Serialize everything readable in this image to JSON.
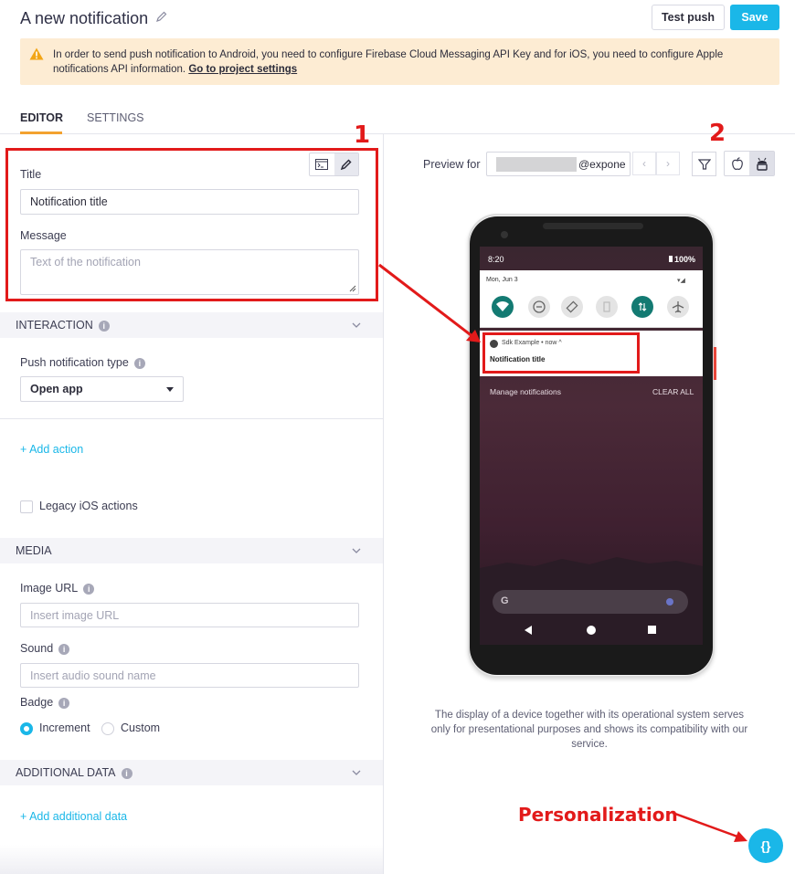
{
  "header": {
    "title": "A new notification",
    "test_push_label": "Test push",
    "save_label": "Save"
  },
  "alert": {
    "text": "In order to send push notification to Android, you need to configure Firebase Cloud Messaging API Key and for iOS, you need to configure Apple notifications API information.",
    "link_label": "Go to project settings"
  },
  "tabs": [
    {
      "label": "EDITOR",
      "active": true
    },
    {
      "label": "SETTINGS",
      "active": false
    }
  ],
  "editor": {
    "title_label": "Title",
    "title_value": "Notification title",
    "message_label": "Message",
    "message_placeholder": "Text of the notification"
  },
  "interaction": {
    "section_title": "INTERACTION",
    "push_type_label": "Push notification type",
    "push_type_value": "Open app",
    "add_action_label": "+ Add action",
    "legacy_label": "Legacy iOS actions",
    "legacy_checked": false
  },
  "media": {
    "section_title": "MEDIA",
    "image_label": "Image URL",
    "image_placeholder": "Insert image URL",
    "sound_label": "Sound",
    "sound_placeholder": "Insert audio sound name",
    "badge_label": "Badge",
    "badge_options": [
      {
        "label": "Increment",
        "selected": true
      },
      {
        "label": "Custom",
        "selected": false
      }
    ]
  },
  "additional": {
    "section_title": "ADDITIONAL DATA",
    "add_label": "+ Add additional data"
  },
  "preview": {
    "label": "Preview for",
    "value_suffix": "@expone",
    "prev_icon": "‹",
    "next_icon": "›"
  },
  "phone": {
    "time": "8:20",
    "battery": "100%",
    "date": "Mon, Jun 3",
    "notif_app": "Sdk Example • now ^",
    "notif_title": "Notification title",
    "manage": "Manage notifications",
    "clear_all": "CLEAR ALL"
  },
  "disclaimer": "The display of a device together with its operational system serves only for presentational purposes and shows its compatibility with our service.",
  "annotations": {
    "one": "1",
    "two": "2",
    "personalization": "Personalization"
  },
  "fab_label": "{}",
  "colors": {
    "accent": "#1ab7e8",
    "tab_underline": "#f3a22f",
    "alert_bg": "#fdecd3",
    "annotation_red": "#e21a1a"
  }
}
